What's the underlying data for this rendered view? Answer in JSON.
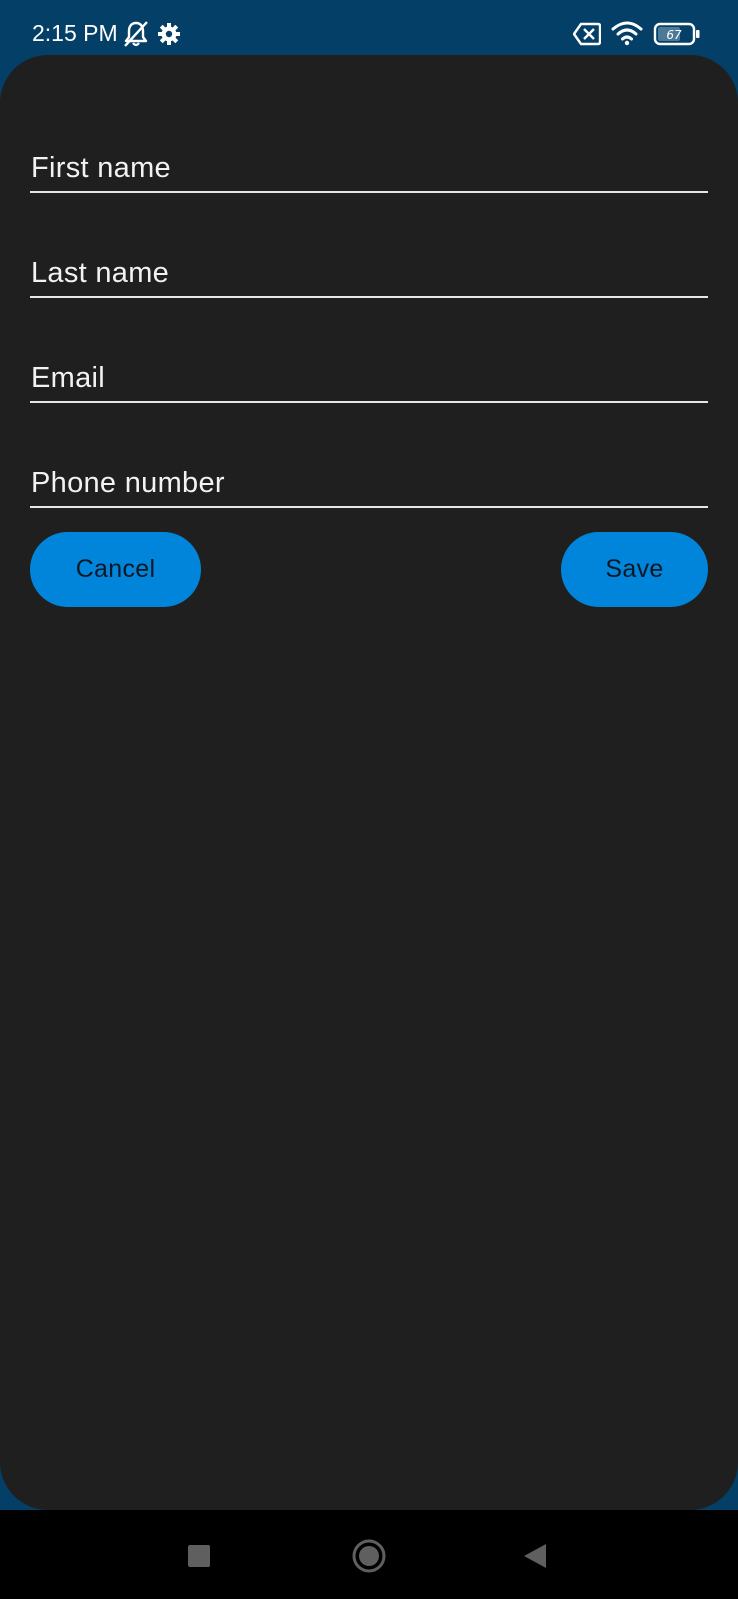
{
  "status_bar": {
    "time": "2:15 PM",
    "battery_level": "67",
    "icons": [
      "notifications-off-icon",
      "settings-gear-icon",
      "sim-disabled-icon",
      "wifi-icon",
      "battery-icon"
    ]
  },
  "form": {
    "fields": [
      {
        "label": "First name",
        "value": ""
      },
      {
        "label": "Last name",
        "value": ""
      },
      {
        "label": "Email",
        "value": ""
      },
      {
        "label": "Phone number",
        "value": ""
      }
    ]
  },
  "actions": {
    "cancel_label": "Cancel",
    "save_label": "Save"
  },
  "nav_bar": {
    "buttons": [
      "recents-square-icon",
      "home-circle-icon",
      "back-triangle-icon"
    ]
  },
  "colors": {
    "status_bar_bg": "#033f66",
    "sheet_bg": "#1f1f1f",
    "button_bg": "#0085db",
    "button_text": "#0b1824",
    "field_text": "#f2f2f2",
    "underline": "#e6e6e6"
  }
}
